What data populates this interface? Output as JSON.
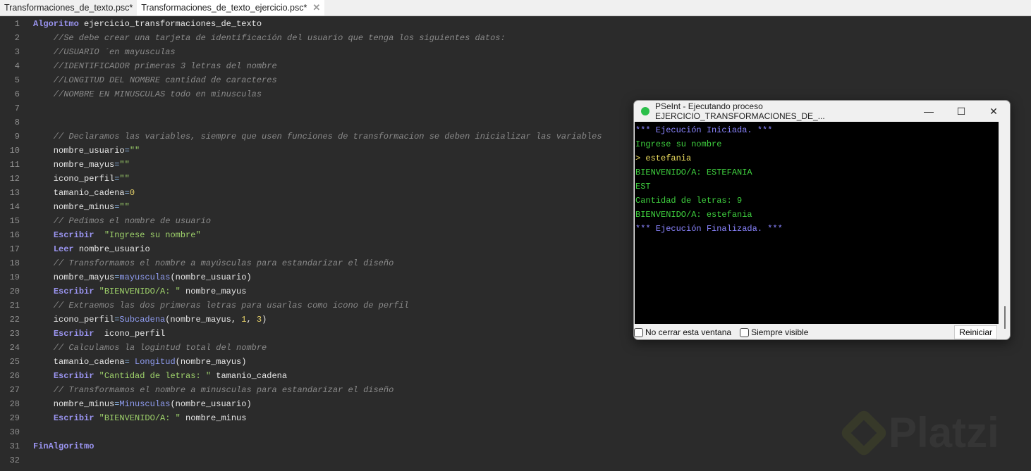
{
  "tabs": [
    {
      "label": "Transformaciones_de_texto.psc*"
    },
    {
      "label": "Transformaciones_de_texto_ejercicio.psc*",
      "close": "✕"
    }
  ],
  "code": [
    [
      [
        "k",
        "Algoritmo"
      ],
      [
        "p",
        " ejercicio_transformaciones_de_texto"
      ]
    ],
    [
      [
        "c",
        "    //Se debe crear una tarjeta de identificación del usuario que tenga los siguientes datos:"
      ]
    ],
    [
      [
        "c",
        "    //USUARIO ´en mayusculas"
      ]
    ],
    [
      [
        "c",
        "    //IDENTIFICADOR primeras 3 letras del nombre"
      ]
    ],
    [
      [
        "c",
        "    //LONGITUD DEL NOMBRE cantidad de caracteres"
      ]
    ],
    [
      [
        "c",
        "    //NOMBRE EN MINUSCULAS todo en minusculas"
      ]
    ],
    [],
    [],
    [
      [
        "c",
        "    // Declaramos las variables, siempre que usen funciones de transformacion se deben inicializar las variables"
      ]
    ],
    [
      [
        "p",
        "    nombre_usuario"
      ],
      [
        "o",
        "="
      ],
      [
        "s",
        "\"\""
      ]
    ],
    [
      [
        "p",
        "    nombre_mayus"
      ],
      [
        "o",
        "="
      ],
      [
        "s",
        "\"\""
      ]
    ],
    [
      [
        "p",
        "    icono_perfil"
      ],
      [
        "o",
        "="
      ],
      [
        "s",
        "\"\""
      ]
    ],
    [
      [
        "p",
        "    tamanio_cadena"
      ],
      [
        "o",
        "="
      ],
      [
        "n",
        "0"
      ]
    ],
    [
      [
        "p",
        "    nombre_minus"
      ],
      [
        "o",
        "="
      ],
      [
        "s",
        "\"\""
      ]
    ],
    [
      [
        "c",
        "    // Pedimos el nombre de usuario"
      ]
    ],
    [
      [
        "p",
        "    "
      ],
      [
        "k",
        "Escribir"
      ],
      [
        "p",
        "  "
      ],
      [
        "s",
        "\"Ingrese su nombre\""
      ]
    ],
    [
      [
        "p",
        "    "
      ],
      [
        "k",
        "Leer"
      ],
      [
        "p",
        " nombre_usuario"
      ]
    ],
    [
      [
        "c",
        "    // Transformamos el nombre a mayúsculas para estandarizar el diseño"
      ]
    ],
    [
      [
        "p",
        "    nombre_mayus"
      ],
      [
        "o",
        "="
      ],
      [
        "f",
        "mayusculas"
      ],
      [
        "p",
        "(nombre_usuario)"
      ]
    ],
    [
      [
        "p",
        "    "
      ],
      [
        "k",
        "Escribir"
      ],
      [
        "p",
        " "
      ],
      [
        "s",
        "\"BIENVENIDO/A: \""
      ],
      [
        "p",
        " nombre_mayus"
      ]
    ],
    [
      [
        "c",
        "    // Extraemos las dos primeras letras para usarlas como icono de perfil"
      ]
    ],
    [
      [
        "p",
        "    icono_perfil"
      ],
      [
        "o",
        "="
      ],
      [
        "f",
        "Subcadena"
      ],
      [
        "p",
        "(nombre_mayus, "
      ],
      [
        "n",
        "1"
      ],
      [
        "p",
        ", "
      ],
      [
        "n",
        "3"
      ],
      [
        "p",
        ")"
      ]
    ],
    [
      [
        "p",
        "    "
      ],
      [
        "k",
        "Escribir"
      ],
      [
        "p",
        "  icono_perfil"
      ]
    ],
    [
      [
        "c",
        "    // Calculamos la logintud total del nombre"
      ]
    ],
    [
      [
        "p",
        "    tamanio_cadena"
      ],
      [
        "o",
        "="
      ],
      [
        "p",
        " "
      ],
      [
        "f",
        "Longitud"
      ],
      [
        "p",
        "(nombre_mayus)"
      ]
    ],
    [
      [
        "p",
        "    "
      ],
      [
        "k",
        "Escribir"
      ],
      [
        "p",
        " "
      ],
      [
        "s",
        "\"Cantidad de letras: \""
      ],
      [
        "p",
        " tamanio_cadena"
      ]
    ],
    [
      [
        "c",
        "    // Transformamos el nombre a minusculas para estandarizar el diseño"
      ]
    ],
    [
      [
        "p",
        "    nombre_minus"
      ],
      [
        "o",
        "="
      ],
      [
        "f",
        "Minusculas"
      ],
      [
        "p",
        "(nombre_usuario)"
      ]
    ],
    [
      [
        "p",
        "    "
      ],
      [
        "k",
        "Escribir"
      ],
      [
        "p",
        " "
      ],
      [
        "s",
        "\"BIENVENIDO/A: \""
      ],
      [
        "p",
        " nombre_minus"
      ]
    ],
    [],
    [
      [
        "k",
        "FinAlgoritmo"
      ]
    ],
    []
  ],
  "console_window": {
    "title": "PSeInt - Ejecutando proceso EJERCICIO_TRANSFORMACIONES_DE_...",
    "minimize": "—",
    "maximize": "☐",
    "close": "✕",
    "lines": [
      [
        "sys",
        "*** Ejecución Iniciada. ***"
      ],
      [
        "out",
        "Ingrese su nombre"
      ],
      [
        "in",
        "> estefania"
      ],
      [
        "out",
        "BIENVENIDO/A: ESTEFANIA"
      ],
      [
        "out",
        "EST"
      ],
      [
        "out",
        "Cantidad de letras: 9"
      ],
      [
        "out",
        "BIENVENIDO/A: estefania"
      ],
      [
        "sys",
        "*** Ejecución Finalizada. ***"
      ]
    ],
    "no_cerrar": "No cerrar esta ventana",
    "siempre_visible": "Siempre visible",
    "reiniciar": "Reiniciar"
  },
  "watermark": "Platzi"
}
